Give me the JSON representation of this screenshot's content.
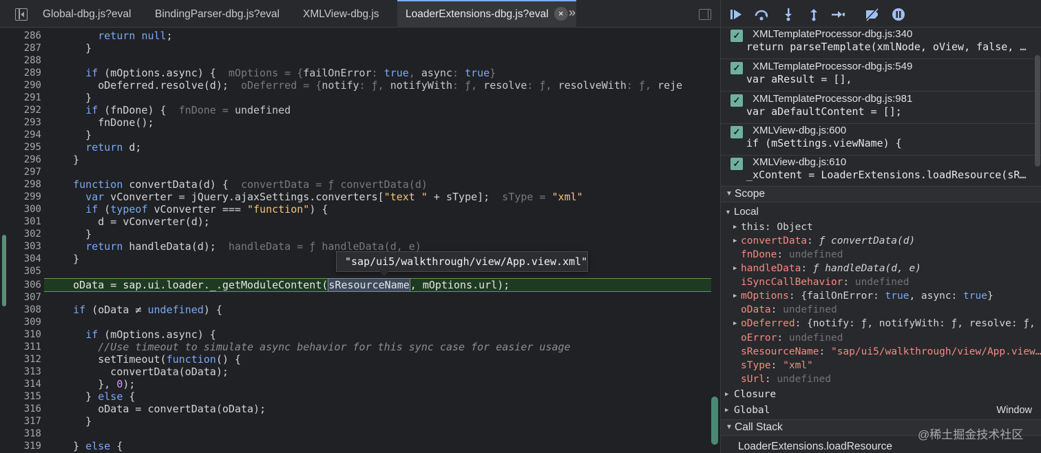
{
  "tabs": [
    {
      "label": "Global-dbg.js?eval"
    },
    {
      "label": "BindingParser-dbg.js?eval"
    },
    {
      "label": "XMLView-dbg.js"
    },
    {
      "label": "LoaderExtensions-dbg.js?eval",
      "close": "×"
    }
  ],
  "tabs_more": "»",
  "editor": {
    "line_numbers": [
      "286",
      "287",
      "288",
      "289",
      "290",
      "291",
      "292",
      "293",
      "294",
      "295",
      "296",
      "297",
      "298",
      "299",
      "300",
      "301",
      "302",
      "303",
      "304",
      "305",
      "306",
      "307",
      "308",
      "309",
      "310",
      "311",
      "312",
      "313",
      "314",
      "315",
      "316",
      "317",
      "318",
      "319"
    ],
    "tooltip": "\"sap/ui5/walkthrough/view/App.view.xml\""
  },
  "breakpoints": [
    {
      "file": "XMLTemplateProcessor-dbg.js:340",
      "code": "return parseTemplate(xmlNode, oView, false, …"
    },
    {
      "file": "XMLTemplateProcessor-dbg.js:549",
      "code": "var aResult = [],"
    },
    {
      "file": "XMLTemplateProcessor-dbg.js:981",
      "code": "var aDefaultContent = [];"
    },
    {
      "file": "XMLView-dbg.js:600",
      "code": "if (mSettings.viewName) {"
    },
    {
      "file": "XMLView-dbg.js:610",
      "code": "_xContent = LoaderExtensions.loadResource(sR…"
    }
  ],
  "scope": {
    "header": "Scope",
    "local_header": "Local",
    "closure": "Closure",
    "global": "Global",
    "global_value": "Window",
    "vars": {
      "this_key": "this",
      "this_val": "Object",
      "convertData_key": "convertData",
      "convertData_f": "ƒ",
      "convertData_val": "convertData(d)",
      "fnDone_key": "fnDone",
      "undefined": "undefined",
      "handleData_key": "handleData",
      "handleData_val": "handleData(d, e)",
      "iSync_key": "iSyncCallBehavior",
      "mOptions_key": "mOptions",
      "mOptions_a": "{failOnError: ",
      "mOptions_b": "true",
      "mOptions_c": ", async: ",
      "mOptions_d": "true",
      "mOptions_e": "}",
      "oData_key": "oData",
      "oDeferred_key": "oDeferred",
      "oDeferred_val": "{notify: ƒ, notifyWith: ƒ, resolve: ƒ, …",
      "oError_key": "oError",
      "sResourceName_key": "sResourceName",
      "sResourceName_val": "\"sap/ui5/walkthrough/view/App.view…",
      "sType_key": "sType",
      "sType_val": "\"xml\"",
      "sUrl_key": "sUrl"
    }
  },
  "call_stack": {
    "header": "Call Stack",
    "first": "LoaderExtensions.loadResource"
  },
  "watermark": "@稀土掘金技术社区"
}
